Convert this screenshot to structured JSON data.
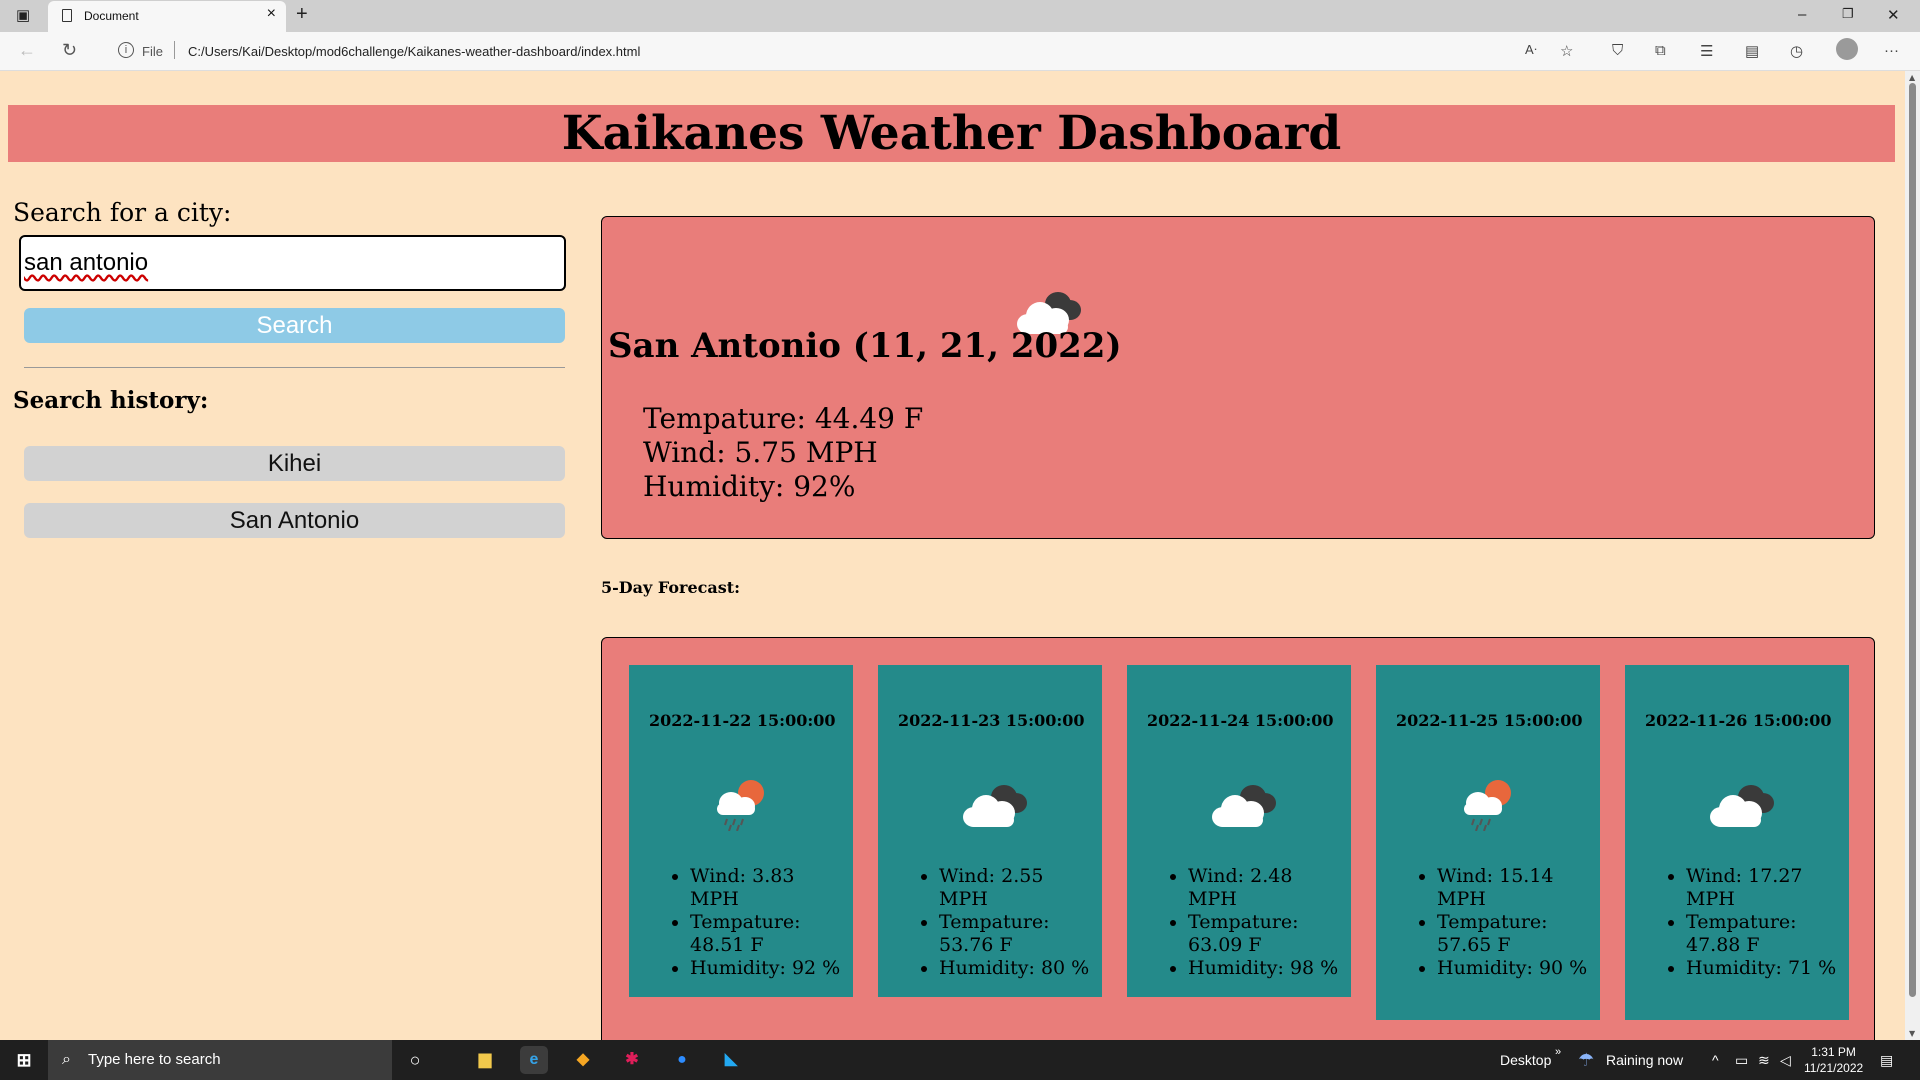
{
  "browser": {
    "tab_title": "Document",
    "address_file": "File",
    "address_url": "C:/Users/Kai/Desktop/mod6challenge/Kaikanes-weather-dashboard/index.html"
  },
  "page": {
    "title": "Kaikanes Weather Dashboard",
    "search_label": "Search for a city:",
    "search_value": "san antonio",
    "search_button": "Search",
    "history_label": "Search history:",
    "history": [
      "Kihei",
      "San Antonio"
    ]
  },
  "current": {
    "heading": "San Antonio (11, 21, 2022)",
    "icon": "cloudy-icon",
    "temperature": "Tempature: 44.49 F",
    "wind": "Wind: 5.75 MPH",
    "humidity": "Humidity: 92%"
  },
  "forecast": {
    "label": "5-Day Forecast:",
    "days": [
      {
        "date": "2022-11-22 15:00:00",
        "icon": "rain-sun-icon",
        "wind": "Wind: 3.83 MPH",
        "temp": "Tempature: 48.51 F",
        "humidity": "Humidity: 92 %"
      },
      {
        "date": "2022-11-23 15:00:00",
        "icon": "cloudy-icon",
        "wind": "Wind: 2.55 MPH",
        "temp": "Tempature: 53.76 F",
        "humidity": "Humidity: 80 %"
      },
      {
        "date": "2022-11-24 15:00:00",
        "icon": "cloudy-icon",
        "wind": "Wind: 2.48 MPH",
        "temp": "Tempature: 63.09 F",
        "humidity": "Humidity: 98 %"
      },
      {
        "date": "2022-11-25 15:00:00",
        "icon": "rain-sun-icon",
        "wind": "Wind: 15.14 MPH",
        "temp": "Tempature: 57.65 F",
        "humidity": "Humidity: 90 %"
      },
      {
        "date": "2022-11-26 15:00:00",
        "icon": "cloudy-icon",
        "wind": "Wind: 17.27 MPH",
        "temp": "Tempature: 47.88 F",
        "humidity": "Humidity: 71 %"
      }
    ]
  },
  "taskbar": {
    "search_placeholder": "Type here to search",
    "desktop_label": "Desktop",
    "weather": "Raining now",
    "time": "1:31 PM",
    "date": "11/21/2022"
  },
  "colors": {
    "page_bg": "#fde3c1",
    "header_bg": "#e97d7a",
    "card_bg": "#248a8a",
    "search_button_bg": "#8ecae6",
    "history_button_bg": "#d2d2d2"
  }
}
